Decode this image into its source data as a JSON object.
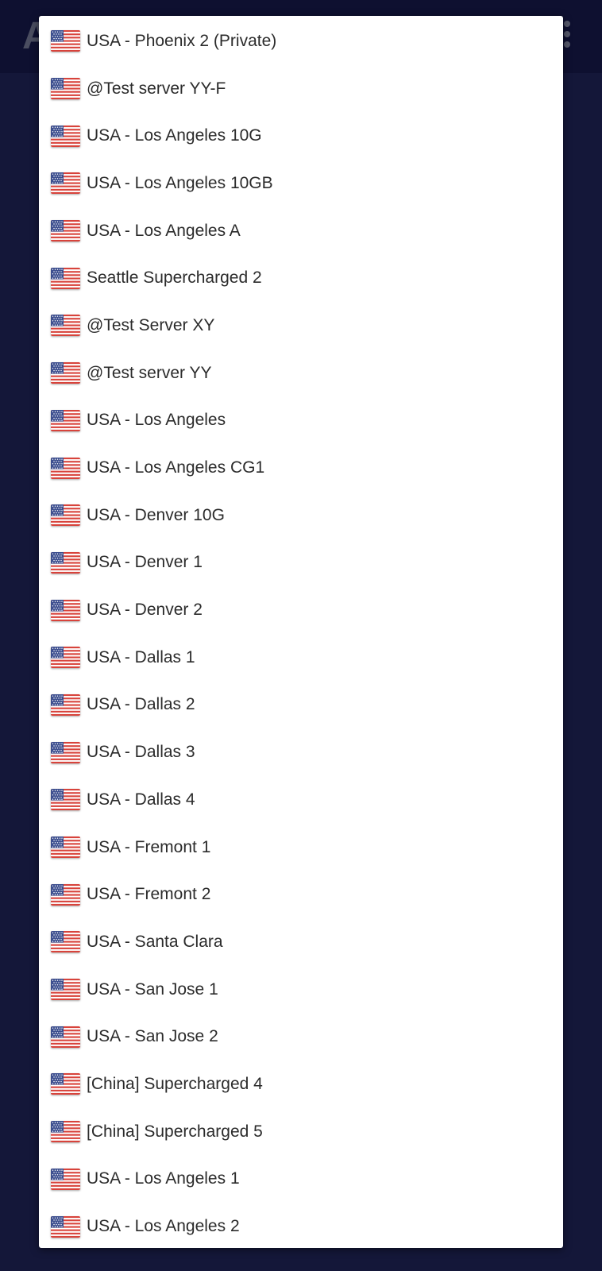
{
  "app": {
    "title_partial": "A        S"
  },
  "dialog": {
    "servers": [
      {
        "label": "USA - Phoenix 2 (Private)",
        "flag": "us-flag-icon"
      },
      {
        "label": "@Test server YY-F",
        "flag": "us-flag-icon"
      },
      {
        "label": "USA - Los Angeles 10G",
        "flag": "us-flag-icon"
      },
      {
        "label": "USA - Los Angeles 10GB",
        "flag": "us-flag-icon"
      },
      {
        "label": "USA - Los Angeles A",
        "flag": "us-flag-icon"
      },
      {
        "label": "Seattle Supercharged 2",
        "flag": "us-flag-icon"
      },
      {
        "label": "@Test Server XY",
        "flag": "us-flag-icon"
      },
      {
        "label": "@Test server YY",
        "flag": "us-flag-icon"
      },
      {
        "label": "USA - Los Angeles",
        "flag": "us-flag-icon"
      },
      {
        "label": "USA - Los Angeles CG1",
        "flag": "us-flag-icon"
      },
      {
        "label": "USA - Denver 10G",
        "flag": "us-flag-icon"
      },
      {
        "label": "USA - Denver 1",
        "flag": "us-flag-icon"
      },
      {
        "label": "USA - Denver 2",
        "flag": "us-flag-icon"
      },
      {
        "label": "USA - Dallas 1",
        "flag": "us-flag-icon"
      },
      {
        "label": "USA - Dallas 2",
        "flag": "us-flag-icon"
      },
      {
        "label": "USA - Dallas 3",
        "flag": "us-flag-icon"
      },
      {
        "label": "USA - Dallas 4",
        "flag": "us-flag-icon"
      },
      {
        "label": "USA - Fremont 1",
        "flag": "us-flag-icon"
      },
      {
        "label": "USA - Fremont 2",
        "flag": "us-flag-icon"
      },
      {
        "label": "USA - Santa Clara",
        "flag": "us-flag-icon"
      },
      {
        "label": "USA - San Jose 1",
        "flag": "us-flag-icon"
      },
      {
        "label": "USA - San Jose 2",
        "flag": "us-flag-icon"
      },
      {
        "label": "[China] Supercharged 4",
        "flag": "us-flag-icon"
      },
      {
        "label": "[China] Supercharged 5",
        "flag": "us-flag-icon"
      },
      {
        "label": "USA - Los Angeles 1",
        "flag": "us-flag-icon"
      },
      {
        "label": "USA - Los Angeles 2",
        "flag": "us-flag-icon"
      }
    ]
  },
  "colors": {
    "background": "#191d4b",
    "dialog": "#ffffff",
    "text": "#2b2b2b",
    "flag_red": "#d8433b",
    "flag_blue": "#3d4f8f"
  }
}
